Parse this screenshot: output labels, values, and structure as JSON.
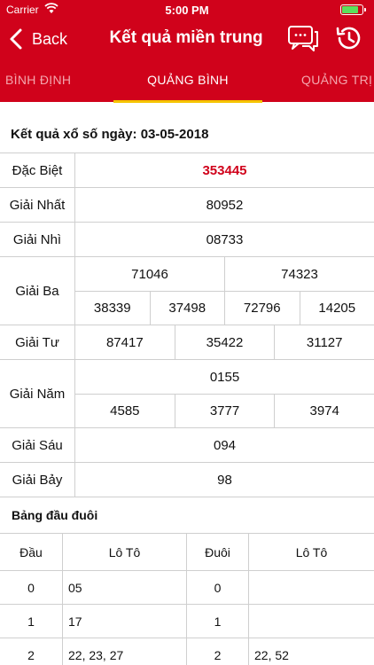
{
  "status": {
    "carrier": "Carrier",
    "time": "5:00 PM"
  },
  "nav": {
    "back_label": "Back",
    "title": "Kết quả miền trung"
  },
  "tabs": [
    {
      "label": "BÌNH ĐỊNH"
    },
    {
      "label": "QUẢNG BÌNH"
    },
    {
      "label": "QUẢNG TRỊ"
    }
  ],
  "result": {
    "date_line": "Kết quả xổ số ngày: 03-05-2018",
    "prizes": {
      "db": {
        "label": "Đặc Biệt",
        "values": [
          "353445"
        ]
      },
      "g1": {
        "label": "Giải Nhất",
        "values": [
          "80952"
        ]
      },
      "g2": {
        "label": "Giải Nhì",
        "values": [
          "08733"
        ]
      },
      "g3": {
        "label": "Giải Ba",
        "rows": [
          [
            "71046",
            "74323"
          ],
          [
            "38339",
            "37498",
            "72796",
            "14205"
          ]
        ]
      },
      "g4": {
        "label": "Giải Tư",
        "values": [
          "87417",
          "35422",
          "31127"
        ]
      },
      "g5": {
        "label": "Giải Năm",
        "rows": [
          [
            "0155"
          ],
          [
            "4585",
            "3777",
            "3974"
          ]
        ]
      },
      "g6": {
        "label": "Giải Sáu",
        "values": [
          "094"
        ]
      },
      "g7": {
        "label": "Giải Bảy",
        "values": [
          "98"
        ]
      }
    }
  },
  "loto": {
    "title": "Bảng đầu đuôi",
    "headers": [
      "Đầu",
      "Lô Tô",
      "Đuôi",
      "Lô Tô"
    ],
    "rows": [
      [
        "0",
        "05",
        "0",
        ""
      ],
      [
        "1",
        "17",
        "1",
        ""
      ],
      [
        "2",
        "22, 23, 27",
        "2",
        "22, 52"
      ]
    ]
  },
  "colors": {
    "brand_red": "#d0021b",
    "tab_indicator": "#f5c400",
    "battery": "#5be05b"
  }
}
